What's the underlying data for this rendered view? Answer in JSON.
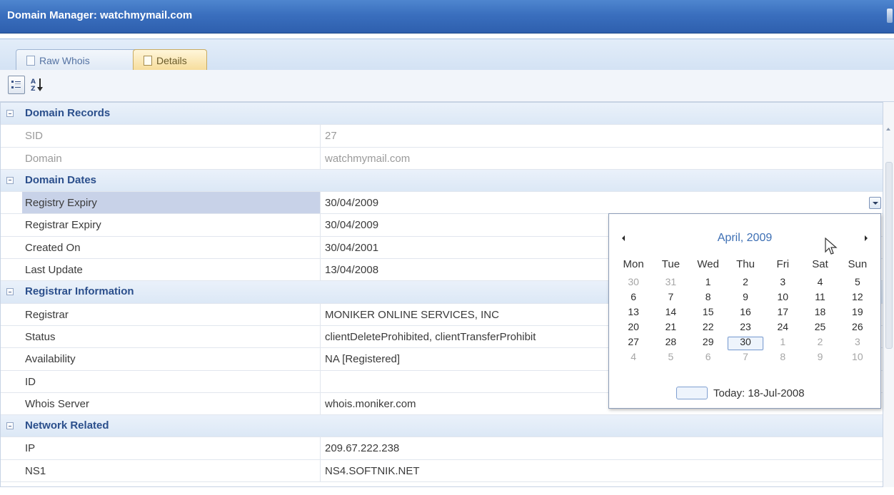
{
  "window": {
    "title": "Domain Manager: watchmymail.com"
  },
  "tabs": [
    {
      "label": "Raw Whois",
      "active": false
    },
    {
      "label": "Details",
      "active": true
    }
  ],
  "toolbar": {
    "categorized_icon": "categorized-icon",
    "alphabetical_icon": "sort-az-icon"
  },
  "grid": {
    "domain_records": {
      "title": "Domain Records",
      "sid": {
        "label": "SID",
        "value": "27"
      },
      "domain": {
        "label": "Domain",
        "value": "watchmymail.com"
      }
    },
    "domain_dates": {
      "title": "Domain Dates",
      "registry_expiry": {
        "label": "Registry Expiry",
        "value": "30/04/2009"
      },
      "registrar_expiry": {
        "label": "Registrar Expiry",
        "value": "30/04/2009"
      },
      "created_on": {
        "label": "Created On",
        "value": "30/04/2001"
      },
      "last_update": {
        "label": "Last Update",
        "value": "13/04/2008"
      }
    },
    "registrar_information": {
      "title": "Registrar Information",
      "registrar": {
        "label": "Registrar",
        "value": "MONIKER ONLINE SERVICES, INC"
      },
      "status": {
        "label": "Status",
        "value": "clientDeleteProhibited, clientTransferProhibit"
      },
      "availability": {
        "label": "Availability",
        "value": "NA [Registered]"
      },
      "id": {
        "label": "ID",
        "value": ""
      },
      "whois_server": {
        "label": "Whois Server",
        "value": "whois.moniker.com"
      }
    },
    "network_related": {
      "title": "Network Related",
      "ip": {
        "label": "IP",
        "value": "209.67.222.238"
      },
      "ns1": {
        "label": "NS1",
        "value": "NS4.SOFTNIK.NET"
      }
    }
  },
  "calendar": {
    "month_label": "April, 2009",
    "weekdays": [
      "Mon",
      "Tue",
      "Wed",
      "Thu",
      "Fri",
      "Sat",
      "Sun"
    ],
    "days": [
      {
        "d": "30",
        "other": true
      },
      {
        "d": "31",
        "other": true
      },
      {
        "d": "1"
      },
      {
        "d": "2"
      },
      {
        "d": "3"
      },
      {
        "d": "4"
      },
      {
        "d": "5"
      },
      {
        "d": "6"
      },
      {
        "d": "7"
      },
      {
        "d": "8"
      },
      {
        "d": "9"
      },
      {
        "d": "10"
      },
      {
        "d": "11"
      },
      {
        "d": "12"
      },
      {
        "d": "13"
      },
      {
        "d": "14"
      },
      {
        "d": "15"
      },
      {
        "d": "16"
      },
      {
        "d": "17"
      },
      {
        "d": "18"
      },
      {
        "d": "19"
      },
      {
        "d": "20"
      },
      {
        "d": "21"
      },
      {
        "d": "22"
      },
      {
        "d": "23"
      },
      {
        "d": "24"
      },
      {
        "d": "25"
      },
      {
        "d": "26"
      },
      {
        "d": "27"
      },
      {
        "d": "28"
      },
      {
        "d": "29"
      },
      {
        "d": "30",
        "selected": true
      },
      {
        "d": "1",
        "other": true
      },
      {
        "d": "2",
        "other": true
      },
      {
        "d": "3",
        "other": true
      },
      {
        "d": "4",
        "other": true
      },
      {
        "d": "5",
        "other": true
      },
      {
        "d": "6",
        "other": true
      },
      {
        "d": "7",
        "other": true
      },
      {
        "d": "8",
        "other": true
      },
      {
        "d": "9",
        "other": true
      },
      {
        "d": "10",
        "other": true
      }
    ],
    "today_label": "Today: 18-Jul-2008"
  },
  "colors": {
    "title_bar": "#3a6fbe",
    "category_text": "#2b4f8c",
    "calendar_month": "#3d6fb4",
    "selected_key_bg": "#c8d2e8"
  }
}
